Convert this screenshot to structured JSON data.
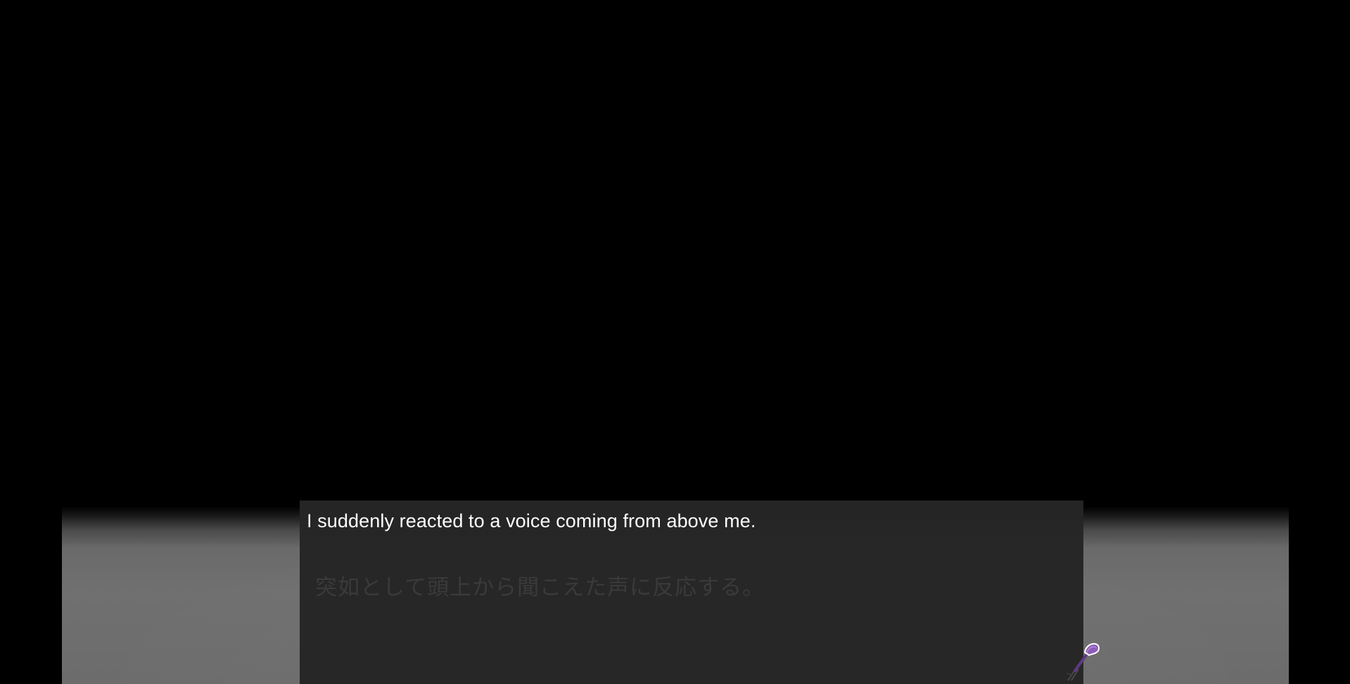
{
  "dialogue": {
    "text": "I suddenly reacted to a voice coming from above me.",
    "original_text": "突如として頭上から聞こえた声に反応する。"
  },
  "advance_indicator": {
    "icon": "quill-pen-icon",
    "color": "#8e5cb8"
  },
  "colors": {
    "background": "#000000",
    "textbox": "#262626",
    "dialogue_text": "#ffffff",
    "original_text": "#3a3a3a",
    "floor": "#6c6c6c"
  }
}
